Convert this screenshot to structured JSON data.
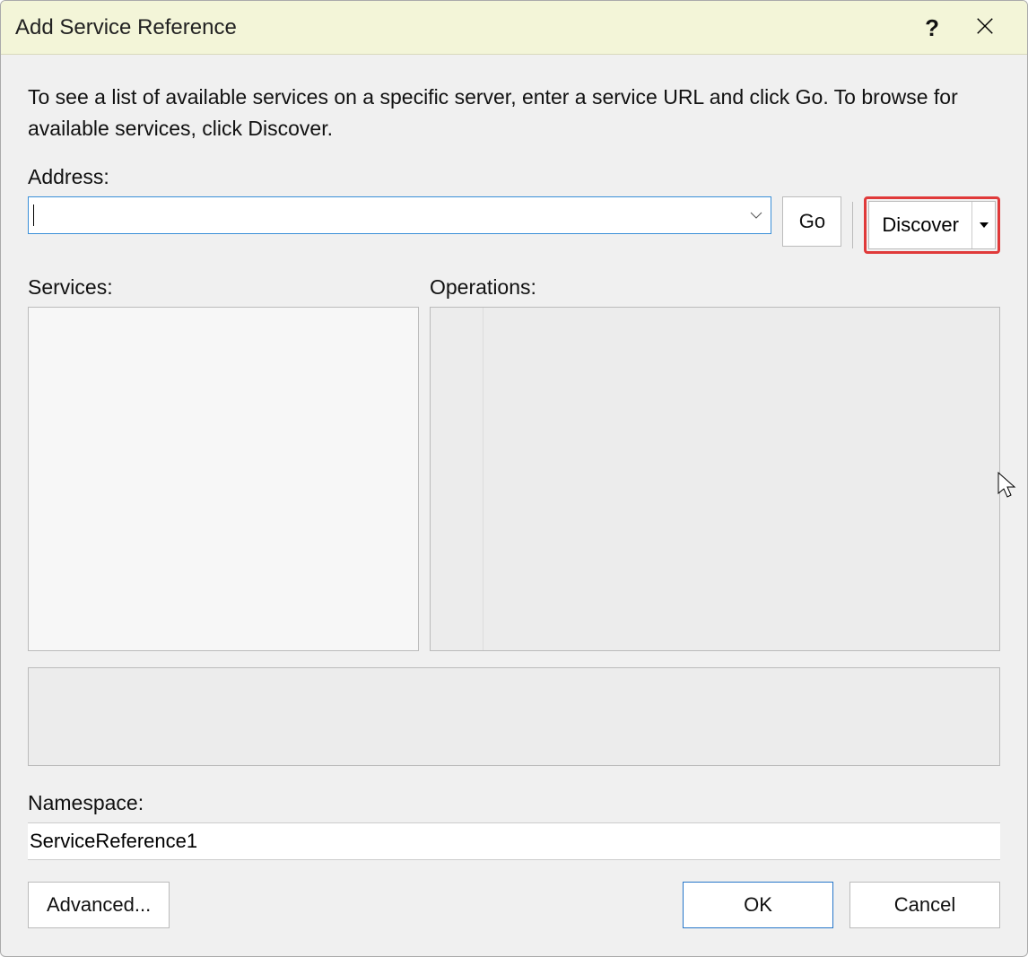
{
  "title": "Add Service Reference",
  "intro_text": "To see a list of available services on a specific server, enter a service URL and click Go. To browse for available services, click Discover.",
  "address": {
    "label": "Address:",
    "value": "",
    "go_label": "Go",
    "discover_label": "Discover"
  },
  "services_label": "Services:",
  "operations_label": "Operations:",
  "namespace": {
    "label": "Namespace:",
    "value": "ServiceReference1"
  },
  "buttons": {
    "advanced": "Advanced...",
    "ok": "OK",
    "cancel": "Cancel"
  }
}
